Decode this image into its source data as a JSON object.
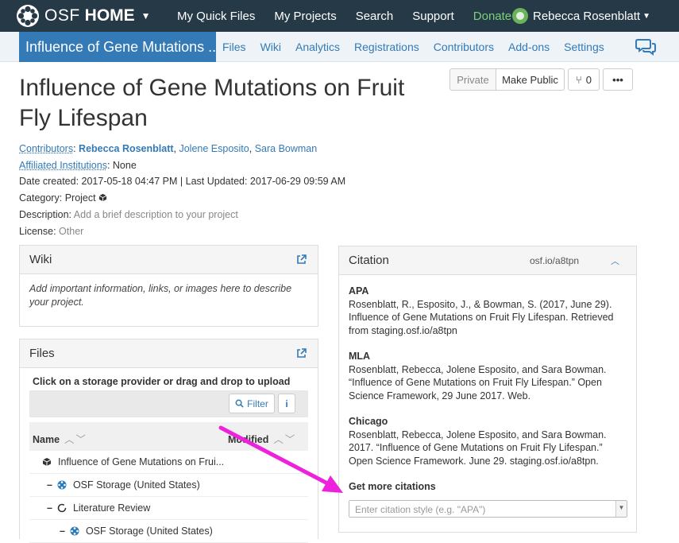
{
  "topbar": {
    "brand_osf": "OSF",
    "brand_home": "HOME",
    "nav": [
      "My Quick Files",
      "My Projects",
      "Search",
      "Support"
    ],
    "donate": "Donate",
    "user_name": "Rebecca Rosenblatt"
  },
  "subnav": {
    "project_title": "Influence of Gene Mutations ...",
    "links": [
      "Files",
      "Wiki",
      "Analytics",
      "Registrations",
      "Contributors",
      "Add-ons",
      "Settings"
    ]
  },
  "actions": {
    "private": "Private",
    "make_public": "Make Public",
    "fork_count": "0",
    "more": "•••"
  },
  "project": {
    "title": "Influence of Gene Mutations on Fruit Fly Lifespan",
    "contributors_label": "Contributors",
    "contributors": [
      "Rebecca Rosenblatt",
      "Jolene Esposito",
      "Sara Bowman"
    ],
    "affiliated_label": "Affiliated Institutions",
    "affiliated_value": "None",
    "dates": "Date created: 2017-05-18 04:47 PM | Last Updated: 2017-06-29 09:59 AM",
    "category_label": "Category:",
    "category_value": "Project",
    "description_label": "Description:",
    "description_value": "Add a brief description to your project",
    "license_label": "License:",
    "license_value": "Other"
  },
  "wiki": {
    "title": "Wiki",
    "body": "Add important information, links, or images here to describe your project."
  },
  "files": {
    "title": "Files",
    "hint": "Click on a storage provider or drag and drop to upload",
    "filter": "Filter",
    "info": "i",
    "col_name": "Name",
    "col_modified": "Modified",
    "rows": [
      {
        "label": "Influence of Gene Mutations on Frui...",
        "dash": "",
        "icon": "cube-icon"
      },
      {
        "label": "OSF Storage (United States)",
        "dash": "–",
        "icon": "osf-storage-icon"
      },
      {
        "label": "Literature Review",
        "dash": "–",
        "icon": "component-icon"
      },
      {
        "label": "OSF Storage (United States)",
        "dash": "–",
        "icon": "osf-storage-icon"
      }
    ]
  },
  "citation": {
    "title": "Citation",
    "url": "osf.io/a8tpn",
    "styles": [
      {
        "name": "APA",
        "text": "Rosenblatt, R., Esposito, J., & Bowman, S. (2017, June 29). Influence of Gene Mutations on Fruit Fly Lifespan. Retrieved from staging.osf.io/a8tpn"
      },
      {
        "name": "MLA",
        "text": "Rosenblatt, Rebecca, Jolene Esposito, and Sara Bowman. “Influence of Gene Mutations on Fruit Fly Lifespan.” Open Science Framework, 29 June 2017. Web."
      },
      {
        "name": "Chicago",
        "text": "Rosenblatt, Rebecca, Jolene Esposito, and Sara Bowman. 2017. “Influence of Gene Mutations on Fruit Fly Lifespan.” Open Science Framework. June 29. staging.osf.io/a8tpn."
      }
    ],
    "more_label": "Get more citations",
    "select_placeholder": "Enter citation style (e.g. \"APA\")"
  },
  "colors": {
    "navbar": "#263947",
    "primary": "#337ab7",
    "donate": "#7ad17a",
    "annotation_arrow": "#ee22dd"
  }
}
